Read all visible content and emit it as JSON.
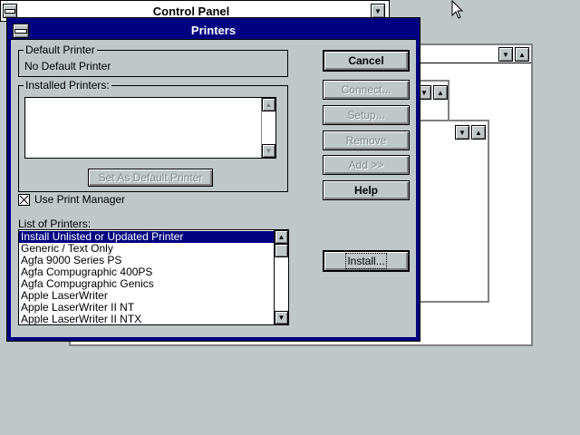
{
  "control_panel": {
    "title": "Control Panel"
  },
  "printers_dialog": {
    "title": "Printers",
    "default_printer": {
      "label": "Default Printer",
      "value": "No Default Printer"
    },
    "installed_printers": {
      "label": "Installed Printers:",
      "items": []
    },
    "set_default_button": "Set As Default Printer",
    "use_print_manager": {
      "label": "Use Print Manager",
      "checked": true
    },
    "list_label": "List of Printers:",
    "printer_list": [
      "Install Unlisted or Updated Printer",
      "Generic / Text Only",
      "Agfa 9000 Series PS",
      "Agfa Compugraphic 400PS",
      "Agfa Compugraphic Genics",
      "Apple LaserWriter",
      "Apple LaserWriter II NT",
      "Apple LaserWriter II NTX"
    ],
    "selected_index": 0,
    "buttons": {
      "cancel": "Cancel",
      "connect": "Connect...",
      "setup": "Setup...",
      "remove": "Remove",
      "add": "Add >>",
      "help": "Help",
      "install": "Install..."
    }
  },
  "colors": {
    "desktop": "#c0c7c8",
    "titlebar_active": "#000080",
    "selection": "#000080"
  }
}
